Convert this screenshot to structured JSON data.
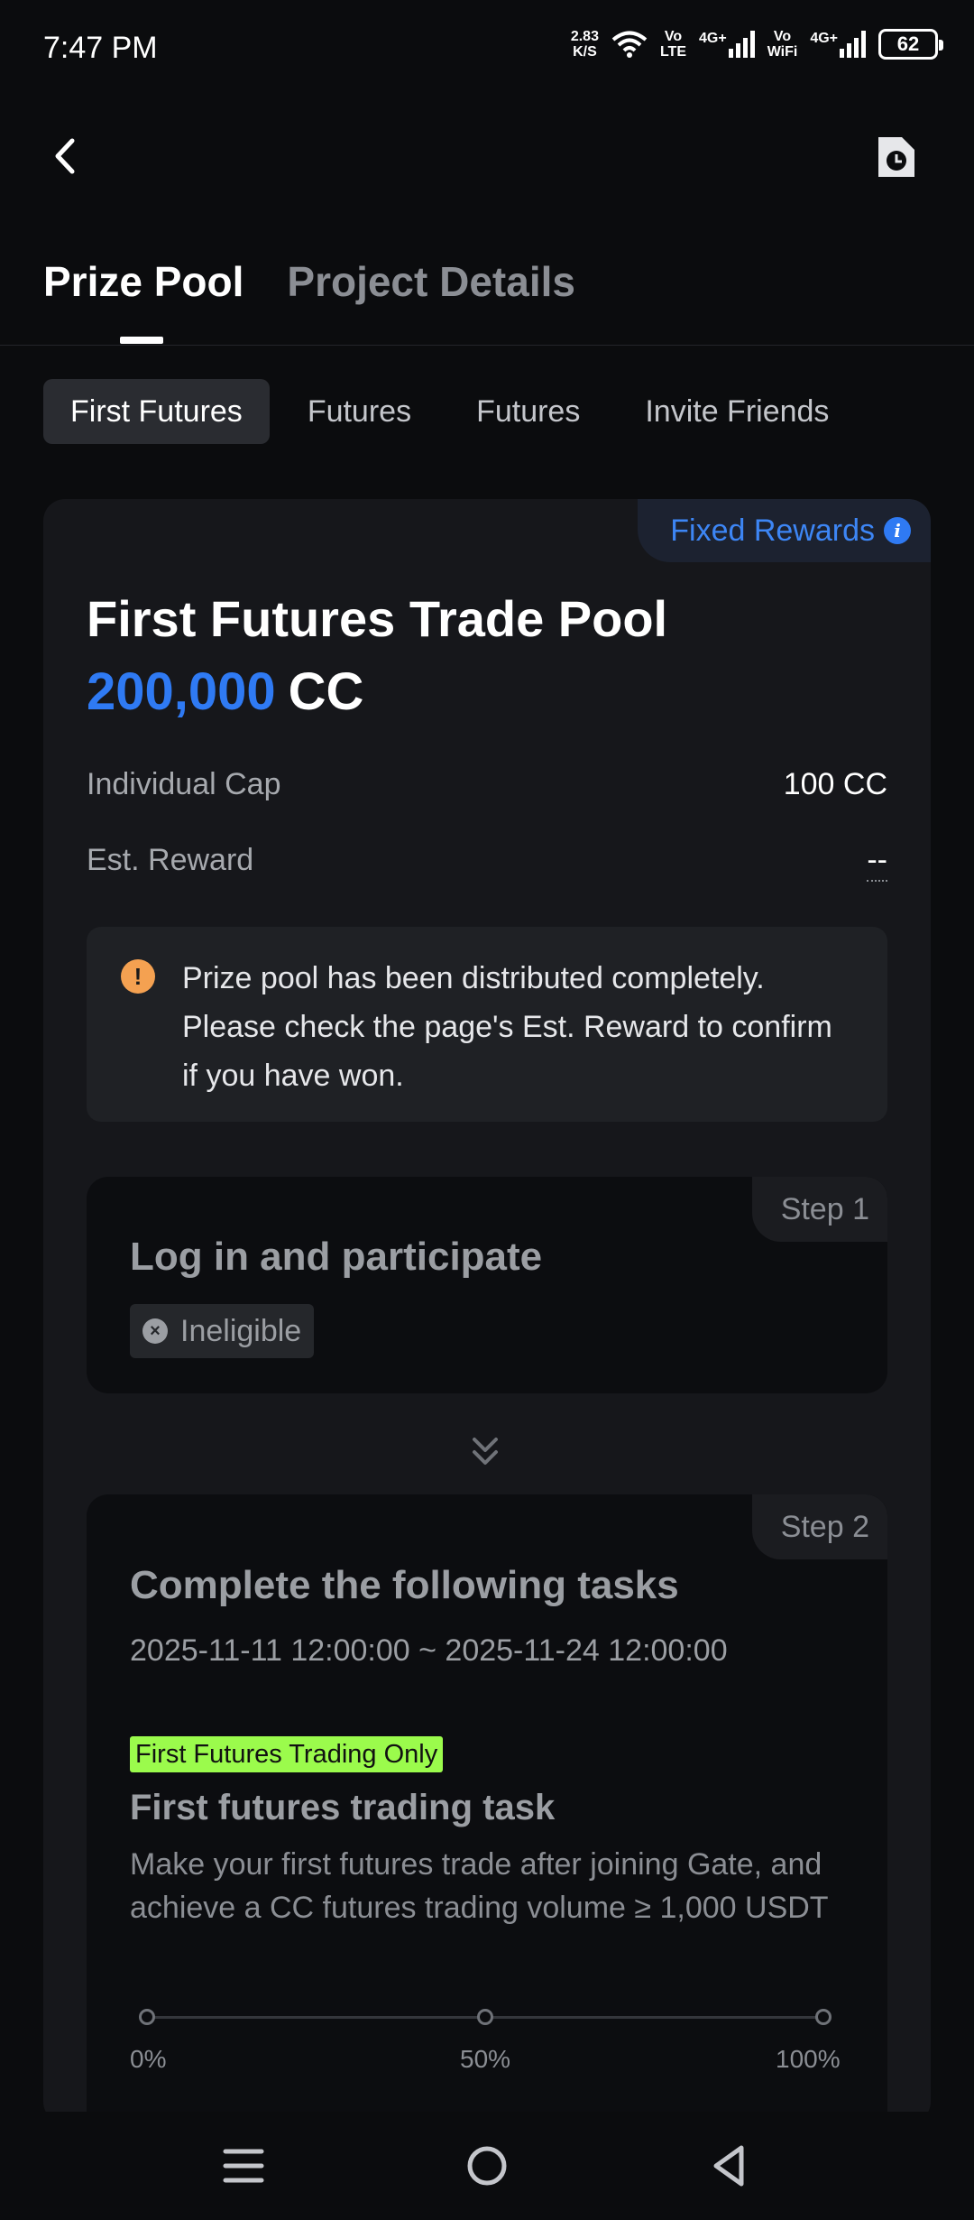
{
  "status_bar": {
    "time": "7:47 PM",
    "net_speed_value": "2.83",
    "net_speed_unit": "K/S",
    "volte1_top": "Vo",
    "volte1_bottom": "LTE",
    "signal1_label": "4G+",
    "vowifi_top": "Vo",
    "vowifi_bottom": "WiFi",
    "signal2_label": "4G+",
    "battery": "62",
    "icons": [
      "wifi-icon",
      "signal-icon",
      "battery-icon"
    ]
  },
  "header": {
    "back_icon": "chevron-left-icon",
    "history_icon": "document-clock-icon"
  },
  "main_tabs": [
    {
      "label": "Prize Pool",
      "active": true
    },
    {
      "label": "Project Details",
      "active": false
    }
  ],
  "sub_tabs": [
    {
      "label": "First Futures",
      "active": true
    },
    {
      "label": "Futures",
      "active": false
    },
    {
      "label": "Futures",
      "active": false
    },
    {
      "label": "Invite Friends",
      "active": false
    }
  ],
  "pool": {
    "badge": "Fixed Rewards",
    "title": "First Futures Trade Pool",
    "amount": "200,000",
    "unit": "CC",
    "individual_cap_label": "Individual Cap",
    "individual_cap_value": "100 CC",
    "est_reward_label": "Est. Reward",
    "est_reward_value": "--"
  },
  "notice": {
    "icon": "!",
    "text": "Prize pool has been distributed completely. Please check the page's Est. Reward to confirm if you have won."
  },
  "step1": {
    "tag": "Step 1",
    "title": "Log in and participate",
    "status_icon": "×",
    "status": "Ineligible"
  },
  "step2": {
    "tag": "Step 2",
    "title": "Complete the following tasks",
    "date_range": "2025-11-11 12:00:00 ~ 2025-11-24 12:00:00",
    "task_badge": "First Futures Trading Only",
    "task_title": "First futures trading task",
    "task_desc": "Make your first futures trade after joining Gate, and achieve a CC futures trading volume ≥ 1,000 USDT",
    "progress_labels": [
      "0%",
      "50%",
      "100%"
    ],
    "progress_value": 0
  },
  "colors": {
    "accent_blue": "#2f7af3",
    "badge_green": "#9bfb4c",
    "warning_orange": "#f4a151",
    "background": "#0b0c0e",
    "card": "#16171b"
  }
}
